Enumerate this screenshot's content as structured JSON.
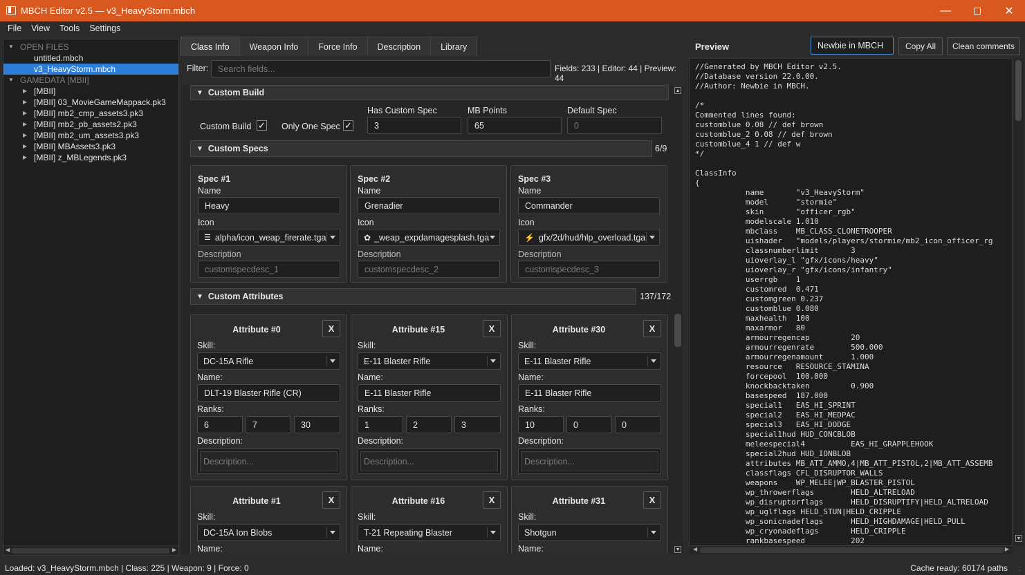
{
  "window": {
    "title": "MBCH Editor v2.5 — v3_HeavyStorm.mbch"
  },
  "menu": [
    "File",
    "View",
    "Tools",
    "Settings"
  ],
  "tree": {
    "open_files_header": "OPEN FILES",
    "open_files": [
      "untitled.mbch",
      "v3_HeavyStorm.mbch"
    ],
    "gamedata_header": "GAMEDATA [MBII]",
    "gamedata": [
      "[MBII]",
      "[MBII] 03_MovieGameMappack.pk3",
      "[MBII] mb2_cmp_assets3.pk3",
      "[MBII] mb2_pb_assets2.pk3",
      "[MBII] mb2_um_assets3.pk3",
      "[MBII] MBAssets3.pk3",
      "[MBII] z_MBLegends.pk3"
    ]
  },
  "tabs": [
    "Class Info",
    "Weapon Info",
    "Force Info",
    "Description",
    "Library"
  ],
  "filter": {
    "label": "Filter:",
    "placeholder": "Search fields...",
    "counts": "Fields: 233 | Editor: 44 | Preview: 44"
  },
  "custom_build": {
    "header": "Custom Build",
    "custom_build_label": "Custom Build",
    "only_one_spec_label": "Only One Spec",
    "has_custom_spec_label": "Has Custom Spec",
    "has_custom_spec": "3",
    "mb_points_label": "MB Points",
    "mb_points": "65",
    "default_spec_label": "Default Spec",
    "default_spec_placeholder": "0"
  },
  "custom_specs": {
    "header": "Custom Specs",
    "count": "6/9",
    "name_label": "Name",
    "icon_label": "Icon",
    "desc_label": "Description",
    "specs": [
      {
        "title": "Spec #1",
        "name": "Heavy",
        "icon": "alpha/icon_weap_firerate.tga",
        "desc": "customspecdesc_1"
      },
      {
        "title": "Spec #2",
        "name": "Grenadier",
        "icon": "_weap_expdamagesplash.tga",
        "desc": "customspecdesc_2"
      },
      {
        "title": "Spec #3",
        "name": "Commander",
        "icon": "gfx/2d/hud/hlp_overload.tga",
        "desc": "customspecdesc_3"
      }
    ]
  },
  "custom_attributes": {
    "header": "Custom Attributes",
    "count": "137/172",
    "skill_label": "Skill:",
    "name_label": "Name:",
    "ranks_label": "Ranks:",
    "desc_label": "Description:",
    "desc_placeholder": "Description...",
    "remove_label": "X",
    "attrs": [
      {
        "title": "Attribute #0",
        "skill": "DC-15A Rifle",
        "name": "DLT-19 Blaster Rifle (CR)",
        "ranks": [
          "6",
          "7",
          "30"
        ]
      },
      {
        "title": "Attribute #15",
        "skill": "E-11 Blaster Rifle",
        "name": "E-11 Blaster Rifle",
        "ranks": [
          "1",
          "2",
          "3"
        ]
      },
      {
        "title": "Attribute #30",
        "skill": "E-11 Blaster Rifle",
        "name": "E-11 Blaster Rifle",
        "ranks": [
          "10",
          "0",
          "0"
        ]
      },
      {
        "title": "Attribute #1",
        "skill": "DC-15A Ion Blobs"
      },
      {
        "title": "Attribute #16",
        "skill": "T-21 Repeating Blaster"
      },
      {
        "title": "Attribute #31",
        "skill": "Shotgun"
      }
    ]
  },
  "preview": {
    "title": "Preview",
    "author_value": "Newbie in MBCH",
    "copy_all": "Copy All",
    "clean_comments": "Clean comments",
    "lines": [
      "//Generated by MBCH Editor v2.5.",
      "//Database version 22.0.00.",
      "//Author: Newbie in MBCH.",
      "",
      "/*",
      "Commented lines found:",
      "customblue 0.08 // def brown",
      "customblue_2 0.08 // def brown",
      "customblue_4 1 // def w",
      "*/",
      "",
      "ClassInfo",
      "{",
      "           name       \"v3_HeavyStorm\"",
      "           model      \"stormie\"",
      "           skin       \"officer_rgb\"",
      "           modelscale 1.010",
      "           mbclass    MB_CLASS_CLONETROOPER",
      "           uishader   \"models/players/stormie/mb2_icon_officer_rg",
      "           classnumberlimit       3",
      "           uioverlay_l \"gfx/icons/heavy\"",
      "           uioverlay_r \"gfx/icons/infantry\"",
      "           userrgb    1",
      "           customred  0.471",
      "           customgreen 0.237",
      "           customblue 0.080",
      "           maxhealth  100",
      "           maxarmor   80",
      "           armourregencap         20",
      "           armourregenrate        500.000",
      "           armourregenamount      1.000",
      "           resource   RESOURCE_STAMINA",
      "           forcepool  100.000",
      "           knockbacktaken         0.900",
      "           basespeed  187.000",
      "           special1   EAS_HI_SPRINT",
      "           special2   EAS_HI_MEDPAC",
      "           special3   EAS_HI_DODGE",
      "           special1hud HUD_CONCBLOB",
      "           meleespecial4          EAS_HI_GRAPPLEHOOK",
      "           special2hud HUD_IONBLOB",
      "           attributes MB_ATT_AMMO,4|MB_ATT_PISTOL,2|MB_ATT_ASSEMB",
      "           classflags CFL_DISRUPTOR_WALLS",
      "           weapons    WP_MELEE|WP_BLASTER_PISTOL",
      "           wp_throwerflags        HELD_ALTRELOAD",
      "           wp_disruptorflags      HELD_DISRUPTIFY|HELD_ALTRELOAD",
      "           wp_uglflags HELD_STUN|HELD_CRIPPLE",
      "           wp_sonicnadeflags      HELD_HIGHDAMAGE|HELD_PULL",
      "           wp_cryonadeflags       HELD_CRIPPLE",
      "           rankbasespeed          202"
    ]
  },
  "status": {
    "left": "Loaded: v3_HeavyStorm.mbch | Class: 225 | Weapon: 9 | Force: 0",
    "right": "Cache ready: 60174 paths"
  }
}
